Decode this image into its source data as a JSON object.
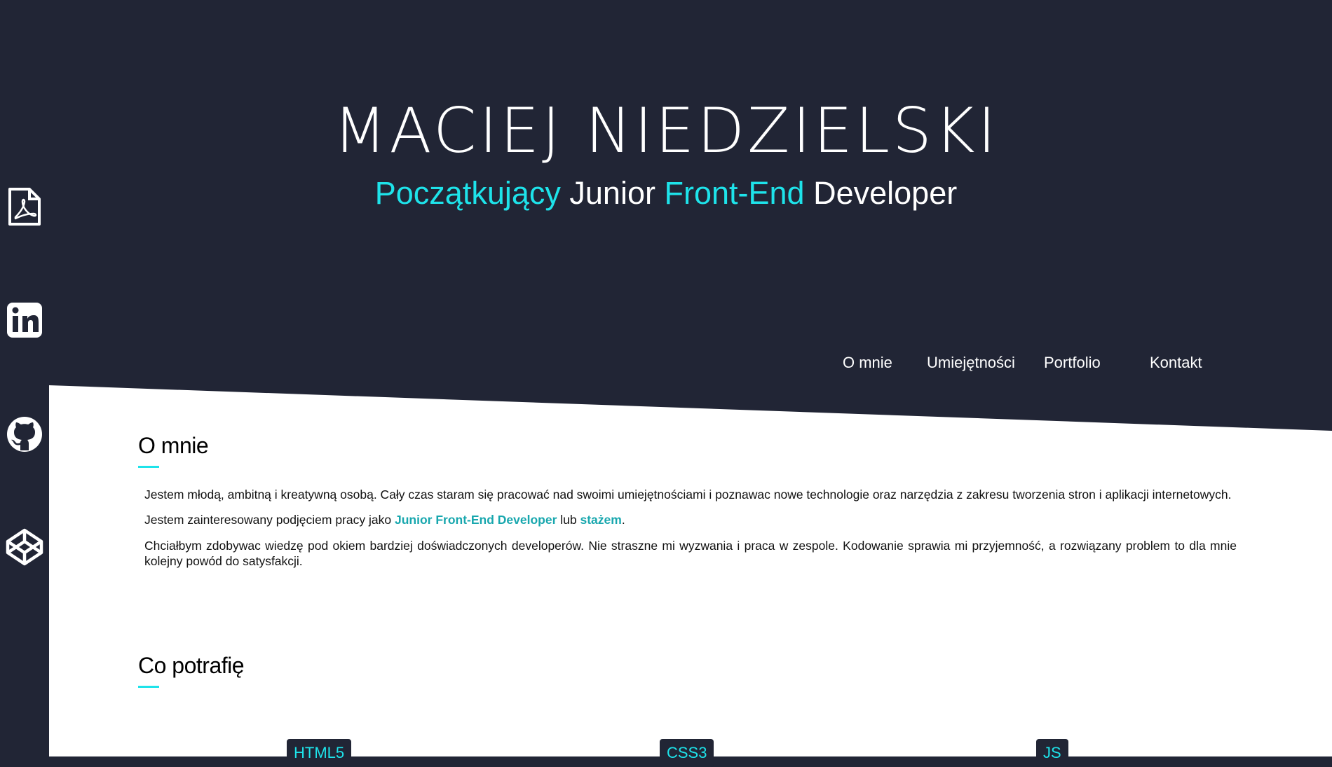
{
  "hero": {
    "name": "MACIEJ NIEDZIELSKI",
    "subtitle": {
      "part1": "Początkujący",
      "part2": "Junior",
      "part3": "Front-End",
      "part4": "Developer"
    }
  },
  "nav": {
    "items": [
      "O mnie",
      "Umiejętności",
      "Portfolio",
      "Kontakt"
    ]
  },
  "sidebar": {
    "icons": [
      "pdf-icon",
      "linkedin-icon",
      "github-icon",
      "codepen-icon"
    ]
  },
  "about": {
    "title": "O mnie",
    "p1": "Jestem młodą, ambitną i kreatywną osobą. Cały czas staram się pracować nad swoimi umiejętnościami i poznawac nowe technologie oraz narzędzia z zakresu tworzenia stron i aplikacji internetowych.",
    "p2_prefix": "Jestem zainteresowany podjęciem pracy jako ",
    "p2_link1": "Junior Front-End Developer",
    "p2_mid": " lub ",
    "p2_link2": "stażem",
    "p2_suffix": ".",
    "p3": "Chciałbym zdobywac wiedzę pod okiem bardziej doświadczonych developerów. Nie straszne mi wyzwania i praca w zespole. Kodowanie sprawia mi przyjemność, a rozwiązany problem to dla mnie kolejny powód do satysfakcji."
  },
  "skills": {
    "title": "Co potrafię",
    "tags": [
      "HTML5",
      "CSS3",
      "JS"
    ]
  },
  "colors": {
    "background": "#212535",
    "accent": "#1ee3ea",
    "link": "#18a7ae"
  }
}
